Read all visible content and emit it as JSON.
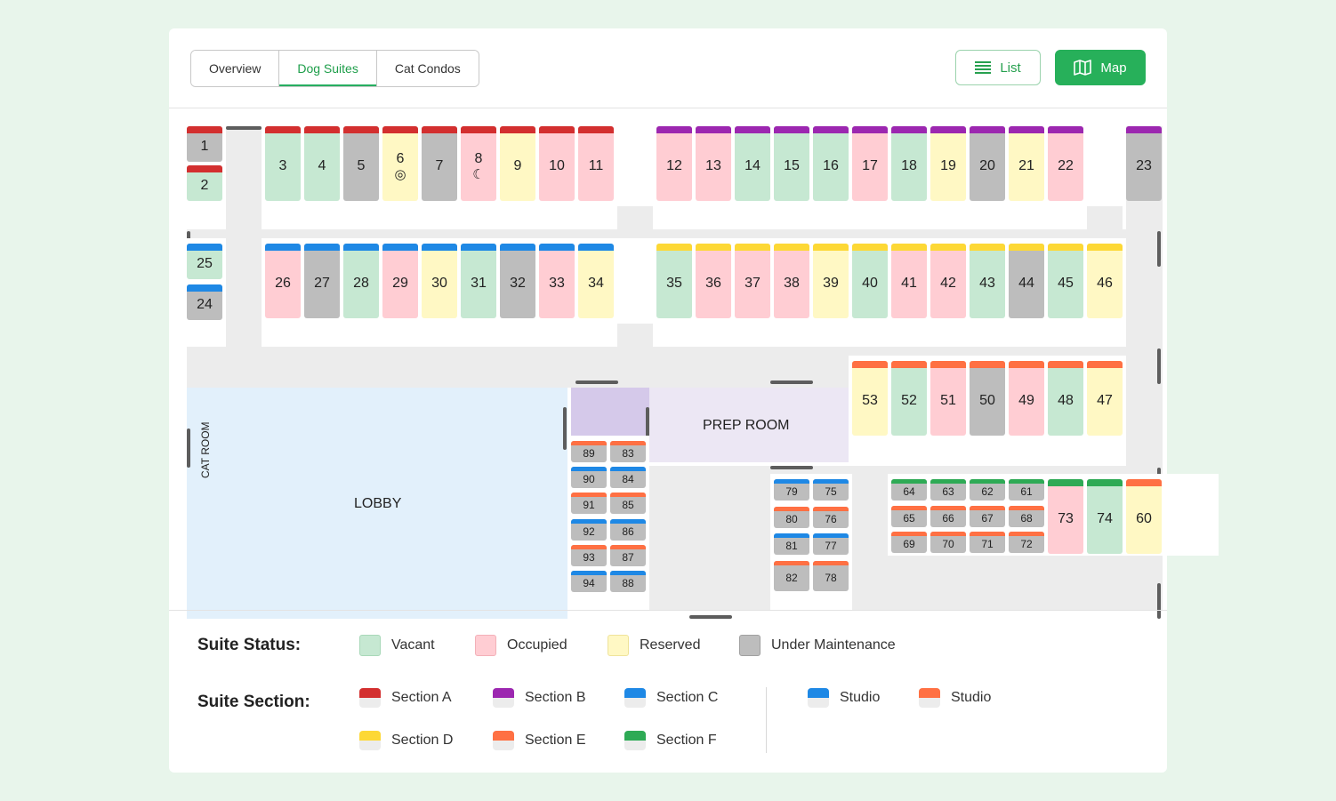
{
  "tabs": [
    {
      "label": "Overview",
      "active": false
    },
    {
      "label": "Dog Suites",
      "active": true
    },
    {
      "label": "Cat Condos",
      "active": false
    }
  ],
  "view_buttons": {
    "list_label": "List",
    "map_label": "Map"
  },
  "status_colors": {
    "vacant": "#c6e8d2",
    "occupied": "#ffcdd3",
    "reserved": "#fff8c4",
    "maintenance": "#bdbdbd"
  },
  "section_colors": {
    "A": "#d32f2f",
    "B": "#9c27b0",
    "C": "#1e88e5",
    "D": "#fdd835",
    "E": "#ff7043",
    "F": "#2eaa55"
  },
  "rooms": {
    "lobby": "LOBBY",
    "prep_room": "PREP ROOM",
    "cat_room": "CAT ROOM"
  },
  "suites": [
    {
      "id": "1",
      "status": "maintenance",
      "section": "A"
    },
    {
      "id": "2",
      "status": "vacant",
      "section": "A"
    },
    {
      "id": "3",
      "status": "vacant",
      "section": "A"
    },
    {
      "id": "4",
      "status": "vacant",
      "section": "A"
    },
    {
      "id": "5",
      "status": "maintenance",
      "section": "A"
    },
    {
      "id": "6",
      "status": "reserved",
      "section": "A",
      "icon": "basketball-icon"
    },
    {
      "id": "7",
      "status": "maintenance",
      "section": "A"
    },
    {
      "id": "8",
      "status": "occupied",
      "section": "A",
      "icon": "moon-icon"
    },
    {
      "id": "9",
      "status": "reserved",
      "section": "A"
    },
    {
      "id": "10",
      "status": "occupied",
      "section": "A"
    },
    {
      "id": "11",
      "status": "occupied",
      "section": "A"
    },
    {
      "id": "12",
      "status": "occupied",
      "section": "B"
    },
    {
      "id": "13",
      "status": "occupied",
      "section": "B"
    },
    {
      "id": "14",
      "status": "vacant",
      "section": "B"
    },
    {
      "id": "15",
      "status": "vacant",
      "section": "B"
    },
    {
      "id": "16",
      "status": "vacant",
      "section": "B"
    },
    {
      "id": "17",
      "status": "occupied",
      "section": "B"
    },
    {
      "id": "18",
      "status": "vacant",
      "section": "B"
    },
    {
      "id": "19",
      "status": "reserved",
      "section": "B"
    },
    {
      "id": "20",
      "status": "maintenance",
      "section": "B"
    },
    {
      "id": "21",
      "status": "reserved",
      "section": "B"
    },
    {
      "id": "22",
      "status": "occupied",
      "section": "B"
    },
    {
      "id": "23",
      "status": "maintenance",
      "section": "B"
    },
    {
      "id": "25",
      "status": "vacant",
      "section": "C"
    },
    {
      "id": "24",
      "status": "maintenance",
      "section": "C"
    },
    {
      "id": "26",
      "status": "occupied",
      "section": "C"
    },
    {
      "id": "27",
      "status": "maintenance",
      "section": "C"
    },
    {
      "id": "28",
      "status": "vacant",
      "section": "C"
    },
    {
      "id": "29",
      "status": "occupied",
      "section": "C"
    },
    {
      "id": "30",
      "status": "reserved",
      "section": "C"
    },
    {
      "id": "31",
      "status": "vacant",
      "section": "C"
    },
    {
      "id": "32",
      "status": "maintenance",
      "section": "C"
    },
    {
      "id": "33",
      "status": "occupied",
      "section": "C"
    },
    {
      "id": "34",
      "status": "reserved",
      "section": "C"
    },
    {
      "id": "35",
      "status": "vacant",
      "section": "D"
    },
    {
      "id": "36",
      "status": "occupied",
      "section": "D"
    },
    {
      "id": "37",
      "status": "occupied",
      "section": "D"
    },
    {
      "id": "38",
      "status": "occupied",
      "section": "D"
    },
    {
      "id": "39",
      "status": "reserved",
      "section": "D"
    },
    {
      "id": "40",
      "status": "vacant",
      "section": "D"
    },
    {
      "id": "41",
      "status": "occupied",
      "section": "D"
    },
    {
      "id": "42",
      "status": "occupied",
      "section": "D"
    },
    {
      "id": "43",
      "status": "vacant",
      "section": "D"
    },
    {
      "id": "44",
      "status": "maintenance",
      "section": "D"
    },
    {
      "id": "45",
      "status": "vacant",
      "section": "D"
    },
    {
      "id": "46",
      "status": "reserved",
      "section": "D"
    },
    {
      "id": "53",
      "status": "reserved",
      "section": "E"
    },
    {
      "id": "52",
      "status": "vacant",
      "section": "E"
    },
    {
      "id": "51",
      "status": "occupied",
      "section": "E"
    },
    {
      "id": "50",
      "status": "maintenance",
      "section": "E"
    },
    {
      "id": "49",
      "status": "occupied",
      "section": "E"
    },
    {
      "id": "48",
      "status": "vacant",
      "section": "E"
    },
    {
      "id": "47",
      "status": "reserved",
      "section": "E"
    },
    {
      "id": "89",
      "status": "maintenance",
      "section": "E"
    },
    {
      "id": "83",
      "status": "maintenance",
      "section": "E"
    },
    {
      "id": "90",
      "status": "maintenance",
      "section": "C"
    },
    {
      "id": "84",
      "status": "maintenance",
      "section": "C"
    },
    {
      "id": "91",
      "status": "maintenance",
      "section": "E"
    },
    {
      "id": "85",
      "status": "maintenance",
      "section": "E"
    },
    {
      "id": "92",
      "status": "maintenance",
      "section": "C"
    },
    {
      "id": "86",
      "status": "maintenance",
      "section": "C"
    },
    {
      "id": "93",
      "status": "maintenance",
      "section": "E"
    },
    {
      "id": "87",
      "status": "maintenance",
      "section": "E"
    },
    {
      "id": "94",
      "status": "maintenance",
      "section": "C"
    },
    {
      "id": "88",
      "status": "maintenance",
      "section": "C"
    },
    {
      "id": "79",
      "status": "maintenance",
      "section": "C"
    },
    {
      "id": "75",
      "status": "maintenance",
      "section": "C"
    },
    {
      "id": "80",
      "status": "maintenance",
      "section": "E"
    },
    {
      "id": "76",
      "status": "maintenance",
      "section": "E"
    },
    {
      "id": "81",
      "status": "maintenance",
      "section": "C"
    },
    {
      "id": "77",
      "status": "maintenance",
      "section": "C"
    },
    {
      "id": "82",
      "status": "maintenance",
      "section": "E"
    },
    {
      "id": "78",
      "status": "maintenance",
      "section": "E"
    },
    {
      "id": "64",
      "status": "maintenance",
      "section": "F"
    },
    {
      "id": "63",
      "status": "maintenance",
      "section": "F"
    },
    {
      "id": "62",
      "status": "maintenance",
      "section": "F"
    },
    {
      "id": "61",
      "status": "maintenance",
      "section": "F"
    },
    {
      "id": "65",
      "status": "maintenance",
      "section": "E"
    },
    {
      "id": "66",
      "status": "maintenance",
      "section": "E"
    },
    {
      "id": "67",
      "status": "maintenance",
      "section": "E"
    },
    {
      "id": "68",
      "status": "maintenance",
      "section": "E"
    },
    {
      "id": "69",
      "status": "maintenance",
      "section": "E"
    },
    {
      "id": "70",
      "status": "maintenance",
      "section": "E"
    },
    {
      "id": "71",
      "status": "maintenance",
      "section": "E"
    },
    {
      "id": "72",
      "status": "maintenance",
      "section": "E"
    },
    {
      "id": "73",
      "status": "occupied",
      "section": "F"
    },
    {
      "id": "74",
      "status": "vacant",
      "section": "F"
    },
    {
      "id": "60",
      "status": "reserved",
      "section": "E"
    }
  ],
  "legend": {
    "status_title": "Suite Status:",
    "status_items": [
      {
        "label": "Vacant",
        "color": "#c6e8d2",
        "border": "#a8d8b8"
      },
      {
        "label": "Occupied",
        "color": "#ffcdd3",
        "border": "#f3b0b8"
      },
      {
        "label": "Reserved",
        "color": "#fff8c4",
        "border": "#efe39a"
      },
      {
        "label": "Under Maintenance",
        "color": "#bdbdbd",
        "border": "#a0a0a0"
      }
    ],
    "section_title": "Suite Section:",
    "section_items": [
      {
        "label": "Section A",
        "color": "#d32f2f"
      },
      {
        "label": "Section B",
        "color": "#9c27b0"
      },
      {
        "label": "Section C",
        "color": "#1e88e5"
      },
      {
        "label": "Section D",
        "color": "#fdd835"
      },
      {
        "label": "Section E",
        "color": "#ff7043"
      },
      {
        "label": "Section F",
        "color": "#2eaa55"
      }
    ],
    "studio_items": [
      {
        "label": "Studio",
        "color": "#1e88e5"
      },
      {
        "label": "Studio",
        "color": "#ff7043"
      }
    ]
  }
}
